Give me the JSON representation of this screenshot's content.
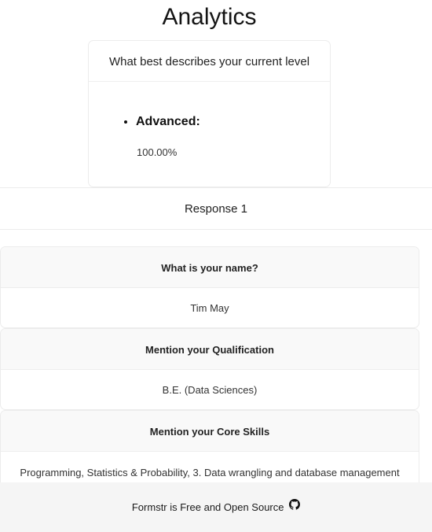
{
  "header": {
    "title": "Analytics"
  },
  "summary_card": {
    "question": "What best describes your current level",
    "option_label": "Advanced:",
    "option_percent": "100.00%"
  },
  "response": {
    "title": "Response 1",
    "items": [
      {
        "question": "What is your name?",
        "answer": "Tim May"
      },
      {
        "question": "Mention your Qualification",
        "answer": "B.E. (Data Sciences)"
      },
      {
        "question": "Mention your Core Skills",
        "answer": "Programming, Statistics & Probability, 3. Data wrangling and database management"
      }
    ]
  },
  "footer": {
    "text": "Formstr is Free and Open Source",
    "icon": "github-icon"
  }
}
